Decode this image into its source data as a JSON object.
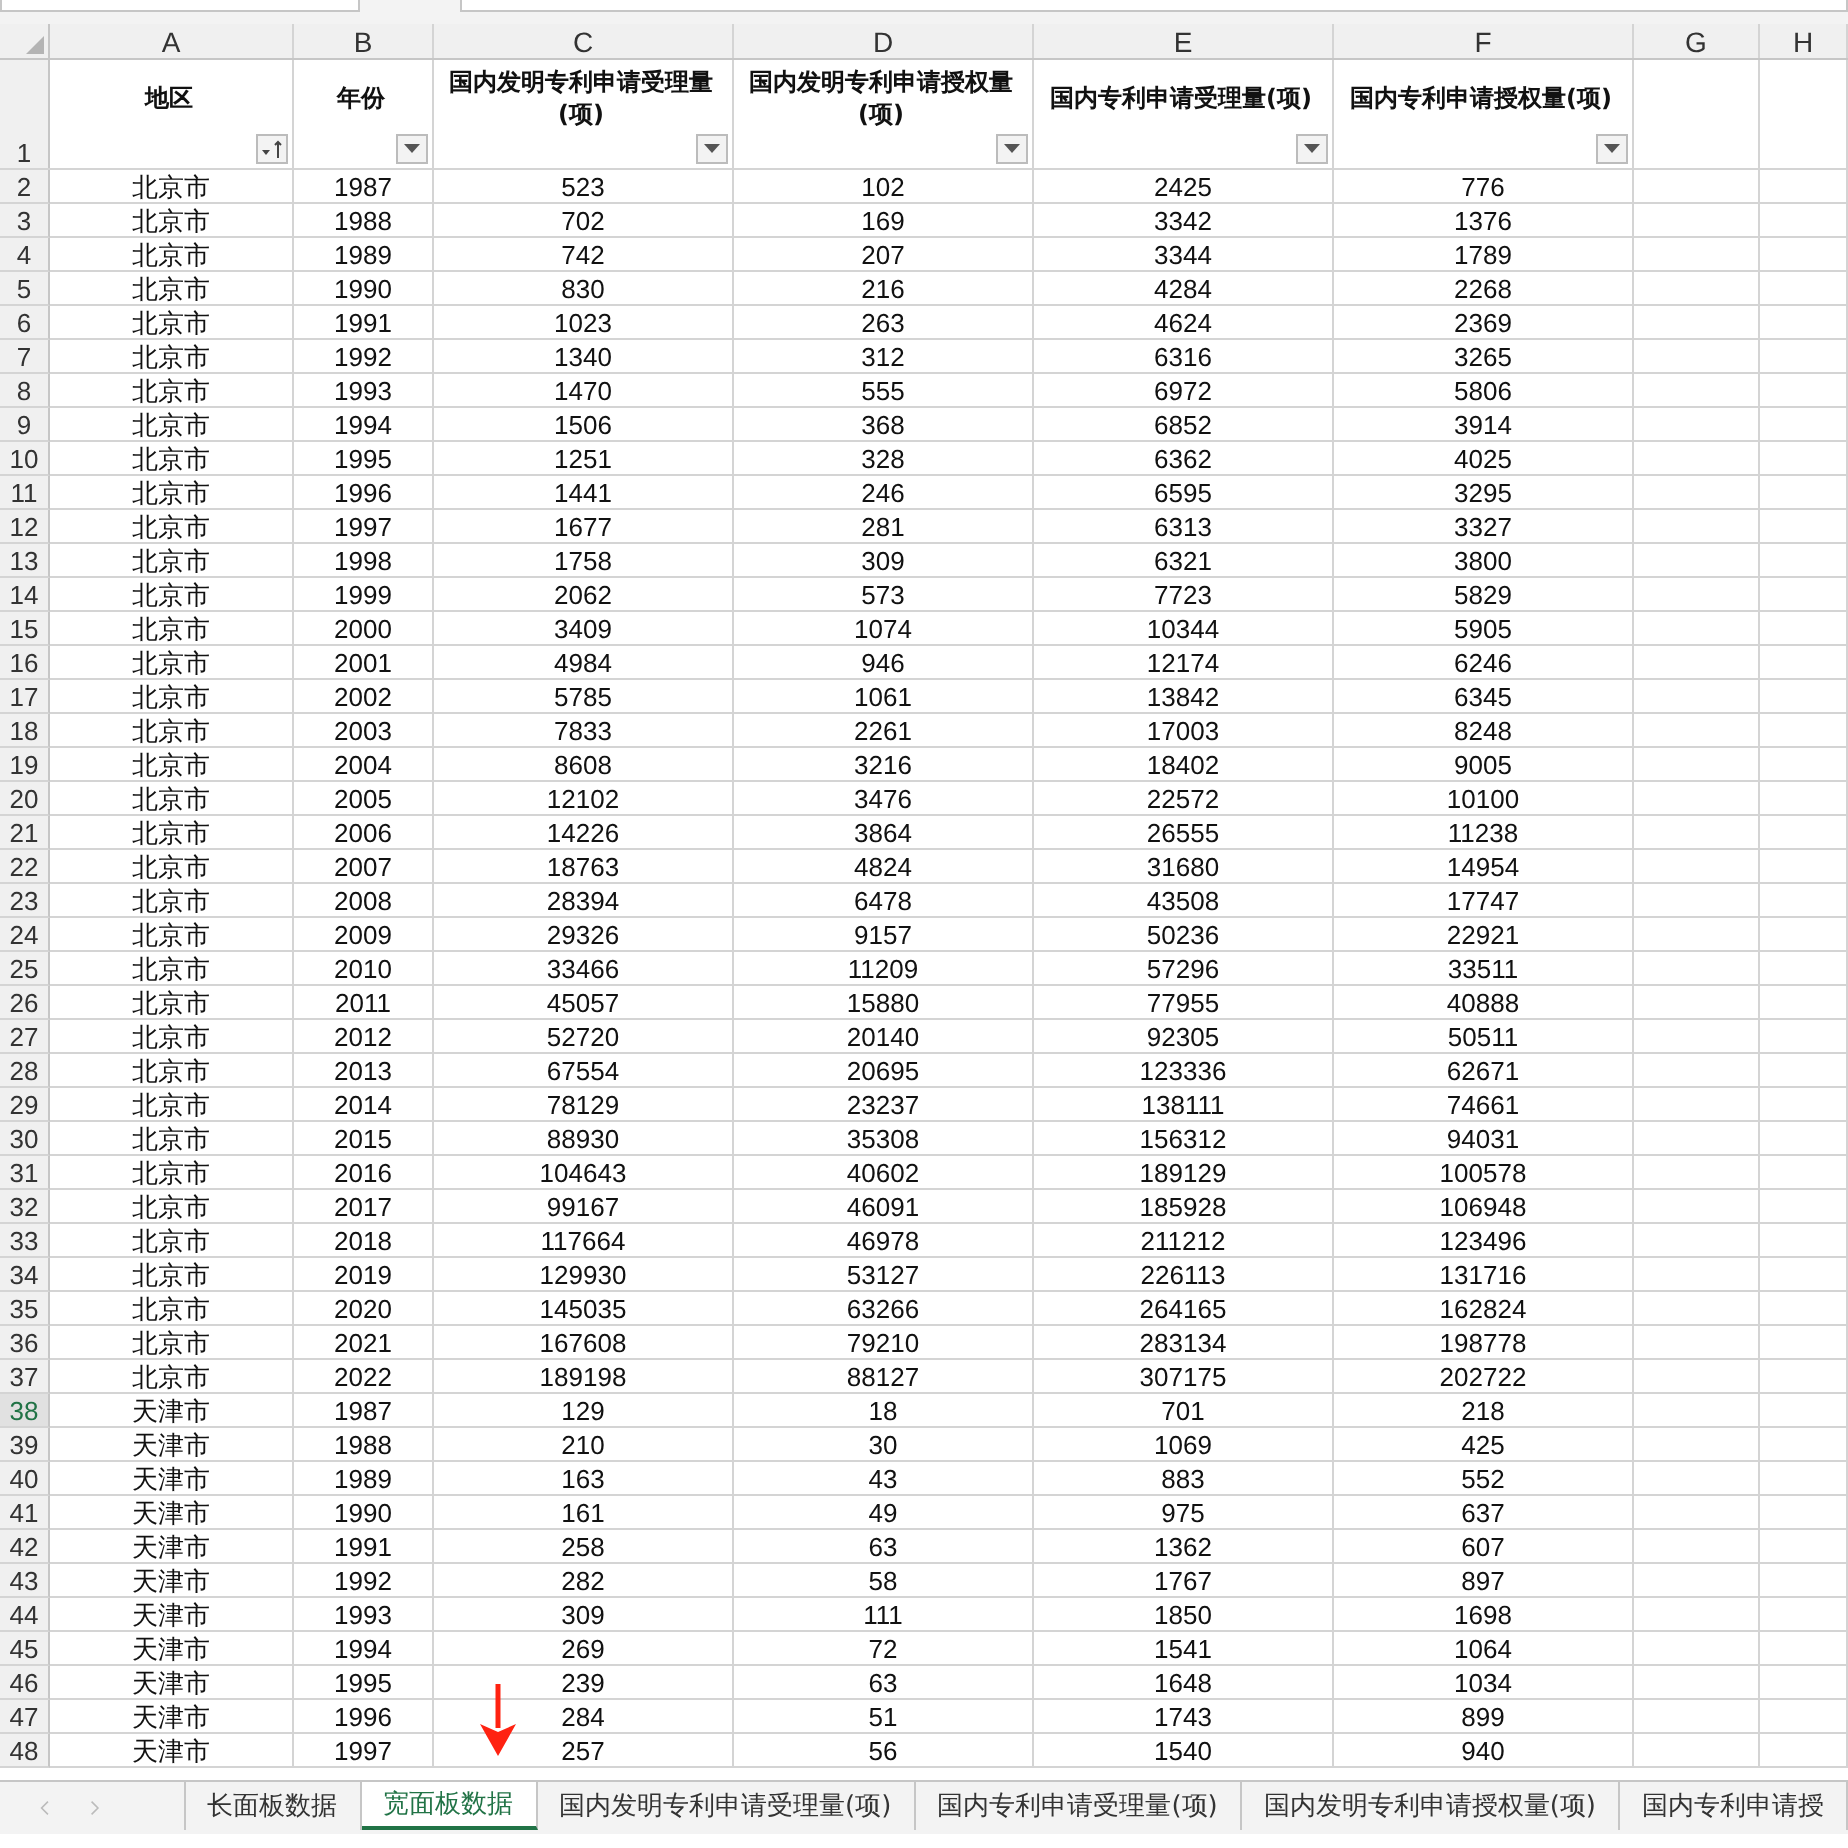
{
  "columns": [
    {
      "letter": "A"
    },
    {
      "letter": "B"
    },
    {
      "letter": "C"
    },
    {
      "letter": "D"
    },
    {
      "letter": "E"
    },
    {
      "letter": "F"
    },
    {
      "letter": "G"
    },
    {
      "letter": "H"
    }
  ],
  "header_row": {
    "number": "1",
    "cells": [
      {
        "text": "地区",
        "kind": "sorted"
      },
      {
        "text": "年份",
        "kind": "dropdown"
      },
      {
        "text": "国内发明专利申请受理量(项)",
        "kind": "dropdown"
      },
      {
        "text": "国内发明专利申请授权量(项)",
        "kind": "dropdown"
      },
      {
        "text": "国内专利申请受理量(项)",
        "kind": "dropdown"
      },
      {
        "text": "国内专利申请授权量(项)",
        "kind": "dropdown"
      }
    ]
  },
  "rows": [
    {
      "number": "2",
      "selected": false,
      "cells": [
        "北京市",
        "1987",
        "523",
        "102",
        "2425",
        "776"
      ]
    },
    {
      "number": "3",
      "selected": false,
      "cells": [
        "北京市",
        "1988",
        "702",
        "169",
        "3342",
        "1376"
      ]
    },
    {
      "number": "4",
      "selected": false,
      "cells": [
        "北京市",
        "1989",
        "742",
        "207",
        "3344",
        "1789"
      ]
    },
    {
      "number": "5",
      "selected": false,
      "cells": [
        "北京市",
        "1990",
        "830",
        "216",
        "4284",
        "2268"
      ]
    },
    {
      "number": "6",
      "selected": false,
      "cells": [
        "北京市",
        "1991",
        "1023",
        "263",
        "4624",
        "2369"
      ]
    },
    {
      "number": "7",
      "selected": false,
      "cells": [
        "北京市",
        "1992",
        "1340",
        "312",
        "6316",
        "3265"
      ]
    },
    {
      "number": "8",
      "selected": false,
      "cells": [
        "北京市",
        "1993",
        "1470",
        "555",
        "6972",
        "5806"
      ]
    },
    {
      "number": "9",
      "selected": false,
      "cells": [
        "北京市",
        "1994",
        "1506",
        "368",
        "6852",
        "3914"
      ]
    },
    {
      "number": "10",
      "selected": false,
      "cells": [
        "北京市",
        "1995",
        "1251",
        "328",
        "6362",
        "4025"
      ]
    },
    {
      "number": "11",
      "selected": false,
      "cells": [
        "北京市",
        "1996",
        "1441",
        "246",
        "6595",
        "3295"
      ]
    },
    {
      "number": "12",
      "selected": false,
      "cells": [
        "北京市",
        "1997",
        "1677",
        "281",
        "6313",
        "3327"
      ]
    },
    {
      "number": "13",
      "selected": false,
      "cells": [
        "北京市",
        "1998",
        "1758",
        "309",
        "6321",
        "3800"
      ]
    },
    {
      "number": "14",
      "selected": false,
      "cells": [
        "北京市",
        "1999",
        "2062",
        "573",
        "7723",
        "5829"
      ]
    },
    {
      "number": "15",
      "selected": false,
      "cells": [
        "北京市",
        "2000",
        "3409",
        "1074",
        "10344",
        "5905"
      ]
    },
    {
      "number": "16",
      "selected": false,
      "cells": [
        "北京市",
        "2001",
        "4984",
        "946",
        "12174",
        "6246"
      ]
    },
    {
      "number": "17",
      "selected": false,
      "cells": [
        "北京市",
        "2002",
        "5785",
        "1061",
        "13842",
        "6345"
      ]
    },
    {
      "number": "18",
      "selected": false,
      "cells": [
        "北京市",
        "2003",
        "7833",
        "2261",
        "17003",
        "8248"
      ]
    },
    {
      "number": "19",
      "selected": false,
      "cells": [
        "北京市",
        "2004",
        "8608",
        "3216",
        "18402",
        "9005"
      ]
    },
    {
      "number": "20",
      "selected": false,
      "cells": [
        "北京市",
        "2005",
        "12102",
        "3476",
        "22572",
        "10100"
      ]
    },
    {
      "number": "21",
      "selected": false,
      "cells": [
        "北京市",
        "2006",
        "14226",
        "3864",
        "26555",
        "11238"
      ]
    },
    {
      "number": "22",
      "selected": false,
      "cells": [
        "北京市",
        "2007",
        "18763",
        "4824",
        "31680",
        "14954"
      ]
    },
    {
      "number": "23",
      "selected": false,
      "cells": [
        "北京市",
        "2008",
        "28394",
        "6478",
        "43508",
        "17747"
      ]
    },
    {
      "number": "24",
      "selected": false,
      "cells": [
        "北京市",
        "2009",
        "29326",
        "9157",
        "50236",
        "22921"
      ]
    },
    {
      "number": "25",
      "selected": false,
      "cells": [
        "北京市",
        "2010",
        "33466",
        "11209",
        "57296",
        "33511"
      ]
    },
    {
      "number": "26",
      "selected": false,
      "cells": [
        "北京市",
        "2011",
        "45057",
        "15880",
        "77955",
        "40888"
      ]
    },
    {
      "number": "27",
      "selected": false,
      "cells": [
        "北京市",
        "2012",
        "52720",
        "20140",
        "92305",
        "50511"
      ]
    },
    {
      "number": "28",
      "selected": false,
      "cells": [
        "北京市",
        "2013",
        "67554",
        "20695",
        "123336",
        "62671"
      ]
    },
    {
      "number": "29",
      "selected": false,
      "cells": [
        "北京市",
        "2014",
        "78129",
        "23237",
        "138111",
        "74661"
      ]
    },
    {
      "number": "30",
      "selected": false,
      "cells": [
        "北京市",
        "2015",
        "88930",
        "35308",
        "156312",
        "94031"
      ]
    },
    {
      "number": "31",
      "selected": false,
      "cells": [
        "北京市",
        "2016",
        "104643",
        "40602",
        "189129",
        "100578"
      ]
    },
    {
      "number": "32",
      "selected": false,
      "cells": [
        "北京市",
        "2017",
        "99167",
        "46091",
        "185928",
        "106948"
      ]
    },
    {
      "number": "33",
      "selected": false,
      "cells": [
        "北京市",
        "2018",
        "117664",
        "46978",
        "211212",
        "123496"
      ]
    },
    {
      "number": "34",
      "selected": false,
      "cells": [
        "北京市",
        "2019",
        "129930",
        "53127",
        "226113",
        "131716"
      ]
    },
    {
      "number": "35",
      "selected": false,
      "cells": [
        "北京市",
        "2020",
        "145035",
        "63266",
        "264165",
        "162824"
      ]
    },
    {
      "number": "36",
      "selected": false,
      "cells": [
        "北京市",
        "2021",
        "167608",
        "79210",
        "283134",
        "198778"
      ]
    },
    {
      "number": "37",
      "selected": false,
      "cells": [
        "北京市",
        "2022",
        "189198",
        "88127",
        "307175",
        "202722"
      ]
    },
    {
      "number": "38",
      "selected": true,
      "cells": [
        "天津市",
        "1987",
        "129",
        "18",
        "701",
        "218"
      ]
    },
    {
      "number": "39",
      "selected": false,
      "cells": [
        "天津市",
        "1988",
        "210",
        "30",
        "1069",
        "425"
      ]
    },
    {
      "number": "40",
      "selected": false,
      "cells": [
        "天津市",
        "1989",
        "163",
        "43",
        "883",
        "552"
      ]
    },
    {
      "number": "41",
      "selected": false,
      "cells": [
        "天津市",
        "1990",
        "161",
        "49",
        "975",
        "637"
      ]
    },
    {
      "number": "42",
      "selected": false,
      "cells": [
        "天津市",
        "1991",
        "258",
        "63",
        "1362",
        "607"
      ]
    },
    {
      "number": "43",
      "selected": false,
      "cells": [
        "天津市",
        "1992",
        "282",
        "58",
        "1767",
        "897"
      ]
    },
    {
      "number": "44",
      "selected": false,
      "cells": [
        "天津市",
        "1993",
        "309",
        "111",
        "1850",
        "1698"
      ]
    },
    {
      "number": "45",
      "selected": false,
      "cells": [
        "天津市",
        "1994",
        "269",
        "72",
        "1541",
        "1064"
      ]
    },
    {
      "number": "46",
      "selected": false,
      "cells": [
        "天津市",
        "1995",
        "239",
        "63",
        "1648",
        "1034"
      ]
    },
    {
      "number": "47",
      "selected": false,
      "cells": [
        "天津市",
        "1996",
        "284",
        "51",
        "1743",
        "899"
      ]
    },
    {
      "number": "48",
      "selected": false,
      "cells": [
        "天津市",
        "1997",
        "257",
        "56",
        "1540",
        "940"
      ]
    }
  ],
  "sheet_tabs": [
    {
      "label": "长面板数据",
      "selected": false
    },
    {
      "label": "宽面板数据",
      "selected": true
    },
    {
      "label": "国内发明专利申请受理量(项)",
      "selected": false
    },
    {
      "label": "国内专利申请受理量(项)",
      "selected": false
    },
    {
      "label": "国内发明专利申请授权量(项)",
      "selected": false
    },
    {
      "label": "国内专利申请授",
      "selected": false
    }
  ]
}
